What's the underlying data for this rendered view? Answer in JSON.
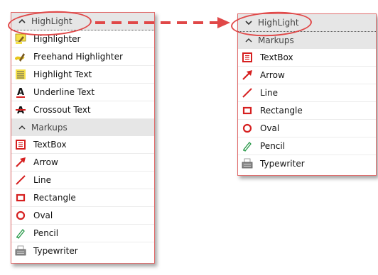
{
  "left_panel": {
    "highlight_header": "HighLight",
    "highlight_items": [
      {
        "label": "Highlighter",
        "icon": "highlighter-icon"
      },
      {
        "label": "Freehand Highlighter",
        "icon": "freehand-highlighter-icon"
      },
      {
        "label": "Highlight Text",
        "icon": "highlight-text-icon"
      },
      {
        "label": "Underline Text",
        "icon": "underline-text-icon"
      },
      {
        "label": "Crossout Text",
        "icon": "crossout-text-icon"
      }
    ],
    "markups_header": "Markups",
    "markups_items": [
      {
        "label": "TextBox",
        "icon": "textbox-icon"
      },
      {
        "label": "Arrow",
        "icon": "arrow-icon"
      },
      {
        "label": "Line",
        "icon": "line-icon"
      },
      {
        "label": "Rectangle",
        "icon": "rectangle-icon"
      },
      {
        "label": "Oval",
        "icon": "oval-icon"
      },
      {
        "label": "Pencil",
        "icon": "pencil-icon"
      },
      {
        "label": "Typewriter",
        "icon": "typewriter-icon"
      }
    ]
  },
  "right_panel": {
    "highlight_header": "HighLight",
    "markups_header": "Markups",
    "markups_items": [
      {
        "label": "TextBox",
        "icon": "textbox-icon"
      },
      {
        "label": "Arrow",
        "icon": "arrow-icon"
      },
      {
        "label": "Line",
        "icon": "line-icon"
      },
      {
        "label": "Rectangle",
        "icon": "rectangle-icon"
      },
      {
        "label": "Oval",
        "icon": "oval-icon"
      },
      {
        "label": "Pencil",
        "icon": "pencil-icon"
      },
      {
        "label": "Typewriter",
        "icon": "typewriter-icon"
      }
    ]
  },
  "colors": {
    "annotation_red": "#e04848",
    "header_gray": "#e6e6e6",
    "panel_border": "#e06b6b"
  }
}
